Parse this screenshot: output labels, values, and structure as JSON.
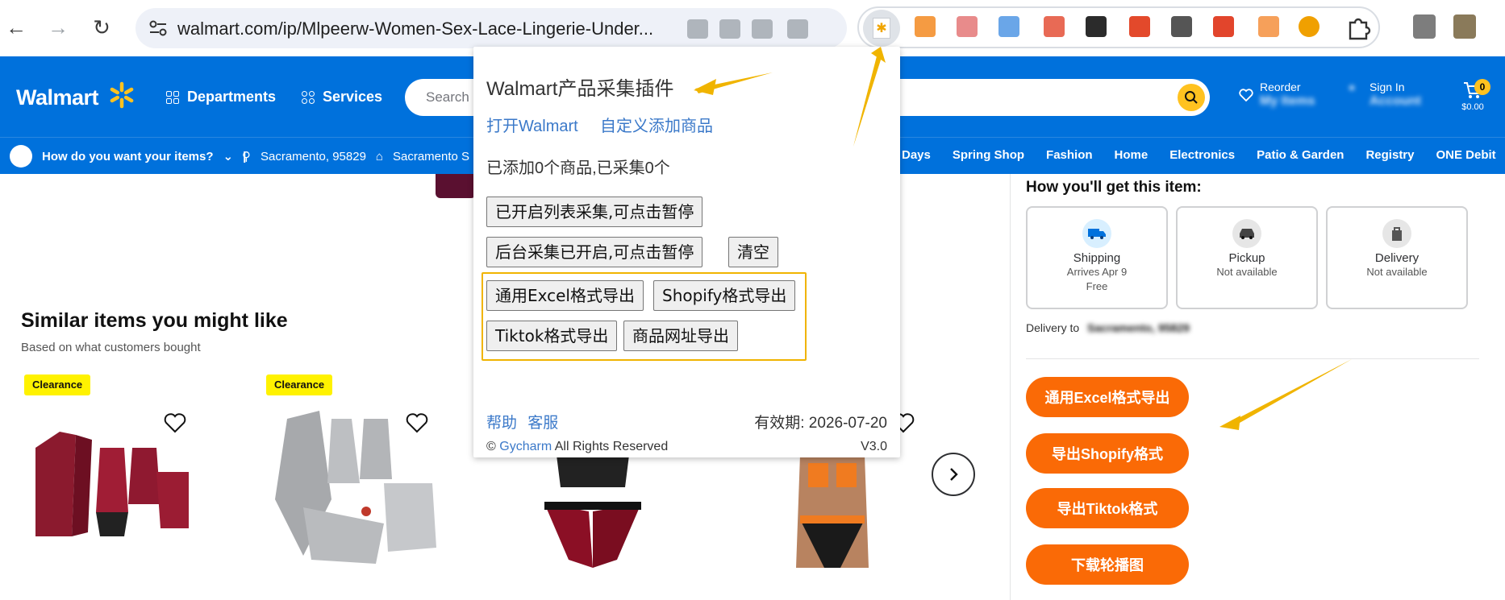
{
  "browser": {
    "url": "walmart.com/ip/Mlpeerw-Women-Sex-Lace-Lingerie-Under..."
  },
  "walmart": {
    "logo": "Walmart",
    "departments": "Departments",
    "services": "Services",
    "search_placeholder": "Search e",
    "reorder": "Reorder",
    "my_items": "My Items",
    "sign_in": "Sign In",
    "account": "Account",
    "cart_count": "0",
    "cart_total": "$0.00"
  },
  "subnav": {
    "how": "How do you want your items?",
    "location": "Sacramento, 95829",
    "store": "Sacramento S",
    "categories": [
      "Days",
      "Spring Shop",
      "Fashion",
      "Home",
      "Electronics",
      "Patio & Garden",
      "Registry",
      "ONE Debit"
    ]
  },
  "similar": {
    "title": "Similar items you might like",
    "subtitle": "Based on what customers bought",
    "badge": "Clearance"
  },
  "fulfillment": {
    "heading": "How you'll get this item:",
    "options": [
      {
        "name": "Shipping",
        "line1": "Arrives Apr 9",
        "line2": "Free"
      },
      {
        "name": "Pickup",
        "line1": "Not available",
        "line2": ""
      },
      {
        "name": "Delivery",
        "line1": "Not available",
        "line2": ""
      }
    ],
    "delivery_to_label": "Delivery to",
    "delivery_to_value": "Sacramento, 95829"
  },
  "side_buttons": [
    "通用Excel格式导出",
    "导出Shopify格式",
    "导出Tiktok格式",
    "下载轮播图"
  ],
  "popup": {
    "title": "Walmart产品采集插件",
    "link_open": "打开Walmart",
    "link_custom": "自定义添加商品",
    "status": "已添加0个商品,已采集0个",
    "btn_list": "已开启列表采集,可点击暂停",
    "btn_background": "后台采集已开启,可点击暂停",
    "btn_clear": "清空",
    "btn_excel": "通用Excel格式导出",
    "btn_shopify": "Shopify格式导出",
    "btn_tiktok": "Tiktok格式导出",
    "btn_url": "商品网址导出",
    "help": "帮助",
    "support": "客服",
    "validity": "有效期: 2026-07-20",
    "copyright_prefix": "©",
    "brand": "Gycharm",
    "rights": "All Rights Reserved",
    "version": "V3.0"
  },
  "colors": {
    "walmart_blue": "#0071dc",
    "walmart_yellow": "#ffc220",
    "action_orange": "#fa6a06",
    "highlight_box": "#f0b400",
    "link_blue": "#3b79c9"
  }
}
